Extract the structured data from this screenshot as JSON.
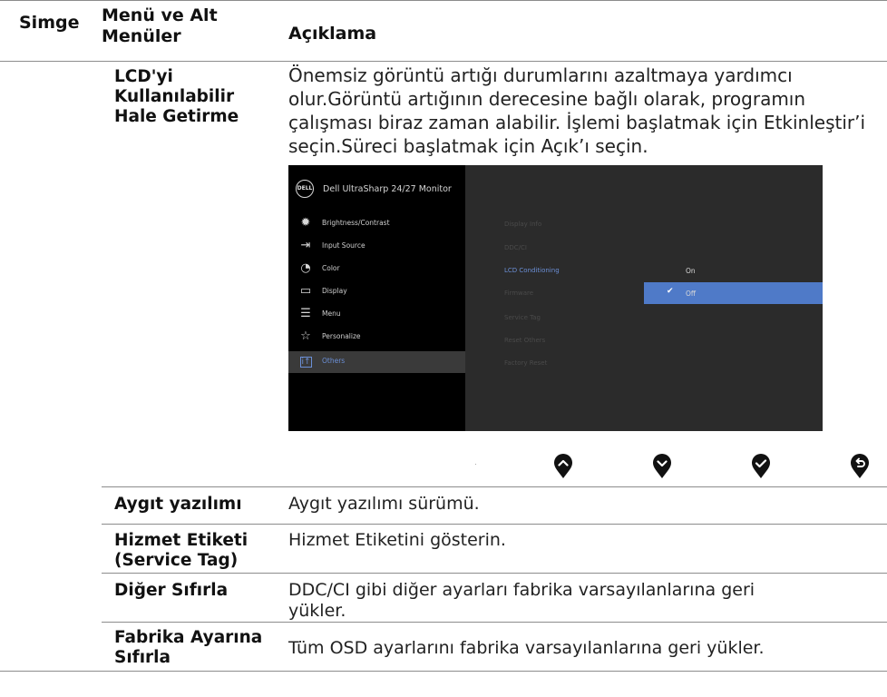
{
  "table": {
    "headers": [
      "Simge",
      "Menü ve Alt Menüler",
      "Açıklama"
    ],
    "rows": [
      {
        "name": "LCD'yi Kullanılabilir Hale Getirme",
        "description": "Önemsiz görüntü artığı durumlarını azaltmaya yardımcı olur.Görüntü artığının derecesine bağlı olarak, programın çalışması biraz zaman alabilir. İşlemi başlatmak için Etkinleştir’i seçin.Süreci başlatmak için Açık’ı seçin."
      },
      {
        "name": "Aygıt yazılımı",
        "description": "Aygıt yazılımı sürümü."
      },
      {
        "name": "Hizmet Etiketi (Service Tag)",
        "description": "Hizmet Etiketini gösterin."
      },
      {
        "name": "Diğer Sıfırla",
        "description": "DDC/CI gibi diğer ayarları fabrika varsayılanlarına geri yükler."
      },
      {
        "name": "Fabrika Ayarına Sıfırla",
        "description": "Tüm OSD ayarlarını fabrika varsayılanlarına geri yükler."
      }
    ]
  },
  "osd": {
    "logo": "DELL",
    "title": "Dell UltraSharp 24/27 Monitor",
    "menu": [
      {
        "label": "Brightness/Contrast",
        "icon": "brightness-icon"
      },
      {
        "label": "Input Source",
        "icon": "input-source-icon"
      },
      {
        "label": "Color",
        "icon": "color-icon"
      },
      {
        "label": "Display",
        "icon": "display-icon"
      },
      {
        "label": "Menu",
        "icon": "menu-icon"
      },
      {
        "label": "Personalize",
        "icon": "star-icon"
      },
      {
        "label": "Others",
        "icon": "others-icon",
        "active": true
      }
    ],
    "submenu": [
      "Display Info",
      "DDC/CI",
      "LCD Conditioning",
      "Firmware",
      "Service Tag",
      "Reset Others",
      "Factory Reset"
    ],
    "options": [
      {
        "label": "On"
      },
      {
        "label": "Off",
        "selected": true
      }
    ],
    "accent_color": "#4f7ac8",
    "buttons": [
      "up-arrow-icon",
      "down-arrow-icon",
      "check-icon",
      "back-icon"
    ]
  }
}
